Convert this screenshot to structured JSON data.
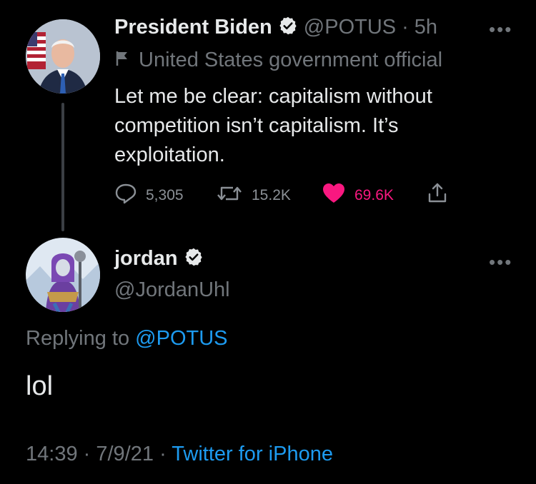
{
  "original_tweet": {
    "author_name": "President Biden",
    "handle": "@POTUS",
    "separator": "·",
    "time_ago": "5h",
    "label": "United States government official",
    "text_lines": [
      "Let me be clear: capitalism without",
      "competition isn’t capitalism. It’s",
      "exploitation."
    ],
    "metrics": {
      "replies": "5,305",
      "retweets": "15.2K",
      "likes": "69.6K"
    },
    "more_label": "•••"
  },
  "reply_tweet": {
    "author_name": "jordan",
    "handle": "@JordanUhl",
    "replying_prefix": "Replying to",
    "replying_to": "@POTUS",
    "text": "lol",
    "time": "14:39",
    "date": "7/9/21",
    "separator": "·",
    "source": "Twitter for iPhone",
    "more_label": "•••"
  },
  "icons": [
    "verified-badge-icon",
    "flag-icon",
    "reply-icon",
    "retweet-icon",
    "heart-icon",
    "share-icon",
    "more-icon"
  ],
  "colors": {
    "background": "#000000",
    "text": "#e7e9ea",
    "muted": "#71767b",
    "link": "#1d9bf0",
    "like": "#f91880"
  }
}
